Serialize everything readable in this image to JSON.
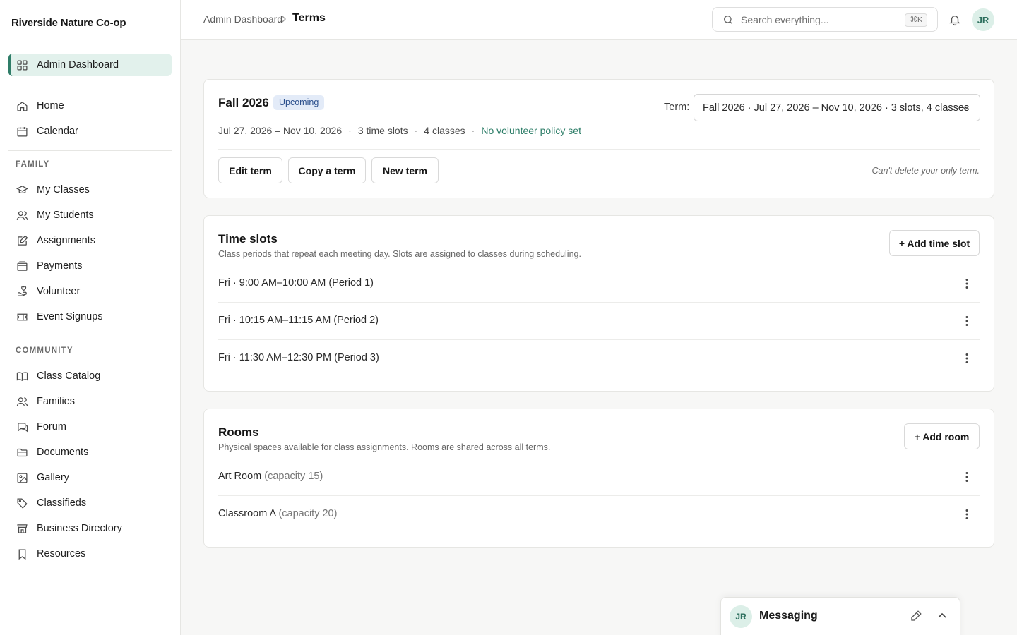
{
  "app": {
    "name": "Riverside Nature Co-op"
  },
  "sidebar": {
    "admin": {
      "label": "Admin Dashboard",
      "icon": "grid-icon"
    },
    "main": [
      {
        "label": "Home",
        "icon": "home-icon"
      },
      {
        "label": "Calendar",
        "icon": "calendar-icon"
      }
    ],
    "family_header": "FAMILY",
    "family": [
      {
        "label": "My Classes",
        "icon": "graduation-cap-icon"
      },
      {
        "label": "My Students",
        "icon": "users-icon"
      },
      {
        "label": "Assignments",
        "icon": "edit-icon"
      },
      {
        "label": "Payments",
        "icon": "wallet-icon"
      },
      {
        "label": "Volunteer",
        "icon": "hand-heart-icon"
      },
      {
        "label": "Event Signups",
        "icon": "ticket-icon"
      }
    ],
    "community_header": "COMMUNITY",
    "community": [
      {
        "label": "Class Catalog",
        "icon": "book-icon"
      },
      {
        "label": "Families",
        "icon": "users-icon"
      },
      {
        "label": "Forum",
        "icon": "chat-icon"
      },
      {
        "label": "Documents",
        "icon": "folder-icon"
      },
      {
        "label": "Gallery",
        "icon": "image-icon"
      },
      {
        "label": "Classifieds",
        "icon": "tag-icon"
      },
      {
        "label": "Business Directory",
        "icon": "store-icon"
      },
      {
        "label": "Resources",
        "icon": "bookmark-icon"
      }
    ]
  },
  "header": {
    "breadcrumb_root": "Admin Dashboard",
    "breadcrumb_current": "Terms",
    "search_placeholder": "Search everything...",
    "search_shortcut": "⌘K",
    "avatar_initials": "JR"
  },
  "term": {
    "name": "Fall 2026",
    "status": "Upcoming",
    "dates": "Jul 27, 2026 – Nov 10, 2026",
    "slots": "3 time slots",
    "classes": "4 classes",
    "policy": "No volunteer policy set",
    "selector_label": "Term:",
    "selector_value": "Fall 2026 · Jul 27, 2026 – Nov 10, 2026 · 3 slots, 4 classes",
    "buttons": {
      "edit": "Edit term",
      "copy": "Copy a term",
      "new": "New term"
    },
    "delete_note": "Can't delete your only term."
  },
  "time_slots": {
    "title": "Time slots",
    "subtitle": "Class periods that repeat each meeting day. Slots are assigned to classes during scheduling.",
    "add_label": "+ Add time slot",
    "items": [
      "Fri · 9:00 AM–10:00 AM (Period 1)",
      "Fri · 10:15 AM–11:15 AM (Period 2)",
      "Fri · 11:30 AM–12:30 PM (Period 3)"
    ]
  },
  "rooms": {
    "title": "Rooms",
    "subtitle": "Physical spaces available for class assignments. Rooms are shared across all terms.",
    "add_label": "+ Add room",
    "items": [
      {
        "name": "Art Room",
        "capacity": "(capacity 15)"
      },
      {
        "name": "Classroom A",
        "capacity": "(capacity 20)"
      }
    ]
  },
  "messaging": {
    "title": "Messaging",
    "avatar_initials": "JR"
  },
  "colors": {
    "accent": "#2f7d68",
    "active_bg": "#e2f1ec",
    "badge_bg": "#e3ebf8",
    "badge_text": "#2b4f8c"
  }
}
